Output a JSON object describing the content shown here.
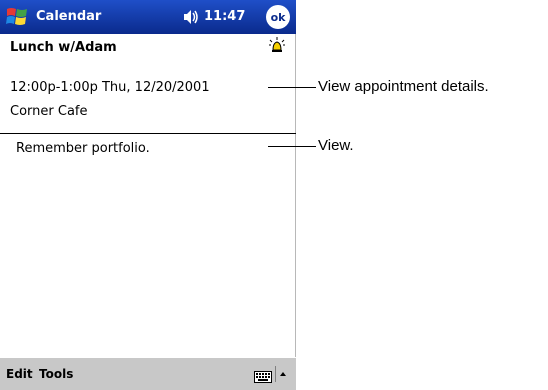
{
  "window": {
    "title": "Calendar",
    "time": "11:47",
    "ok_label": "ok"
  },
  "appointment": {
    "subject": "Lunch w/Adam",
    "when": "12:00p-1:00p Thu, 12/20/2001",
    "location": "Corner Cafe",
    "notes": "Remember portfolio."
  },
  "menubar": {
    "items": [
      "Edit",
      "Tools"
    ]
  },
  "callouts": [
    {
      "text": "View appointment details."
    },
    {
      "text": "View."
    }
  ],
  "icons": {
    "start": "windows-flag-icon",
    "volume": "speaker-icon",
    "reminder": "bell-icon",
    "keyboard": "keyboard-icon",
    "arrow": "up-arrow-icon"
  },
  "colors": {
    "titlebar": "#0a2a8c",
    "menubar": "#c8c8c8"
  }
}
